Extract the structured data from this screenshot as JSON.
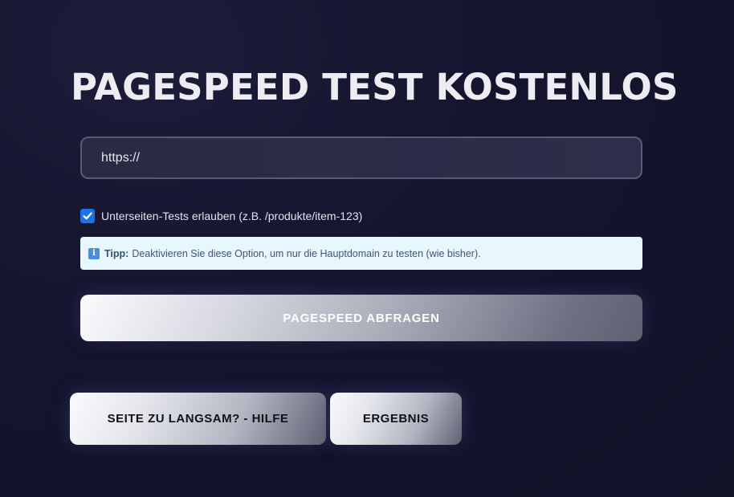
{
  "header": {
    "title": "PAGESPEED TEST KOSTENLOS"
  },
  "form": {
    "url_placeholder": "https://",
    "url_value": "",
    "subpages_checked": true,
    "subpages_label": "Unterseiten-Tests erlauben (z.B. /produkte/item-123)",
    "tip_icon": "info-icon",
    "tip_icon_glyph": "i",
    "tip_label": "Tipp:",
    "tip_text": "Deaktivieren Sie diese Option, um nur die Hauptdomain zu testen (wie bisher).",
    "submit_label": "PAGESPEED ABFRAGEN"
  },
  "actions": {
    "help_label": "SEITE ZU LANGSAM? - HILFE",
    "result_label": "ERGEBNIS"
  },
  "colors": {
    "background": "#14142e",
    "checkbox_accent": "#1a73e8",
    "tip_background": "#e8f6fd"
  }
}
